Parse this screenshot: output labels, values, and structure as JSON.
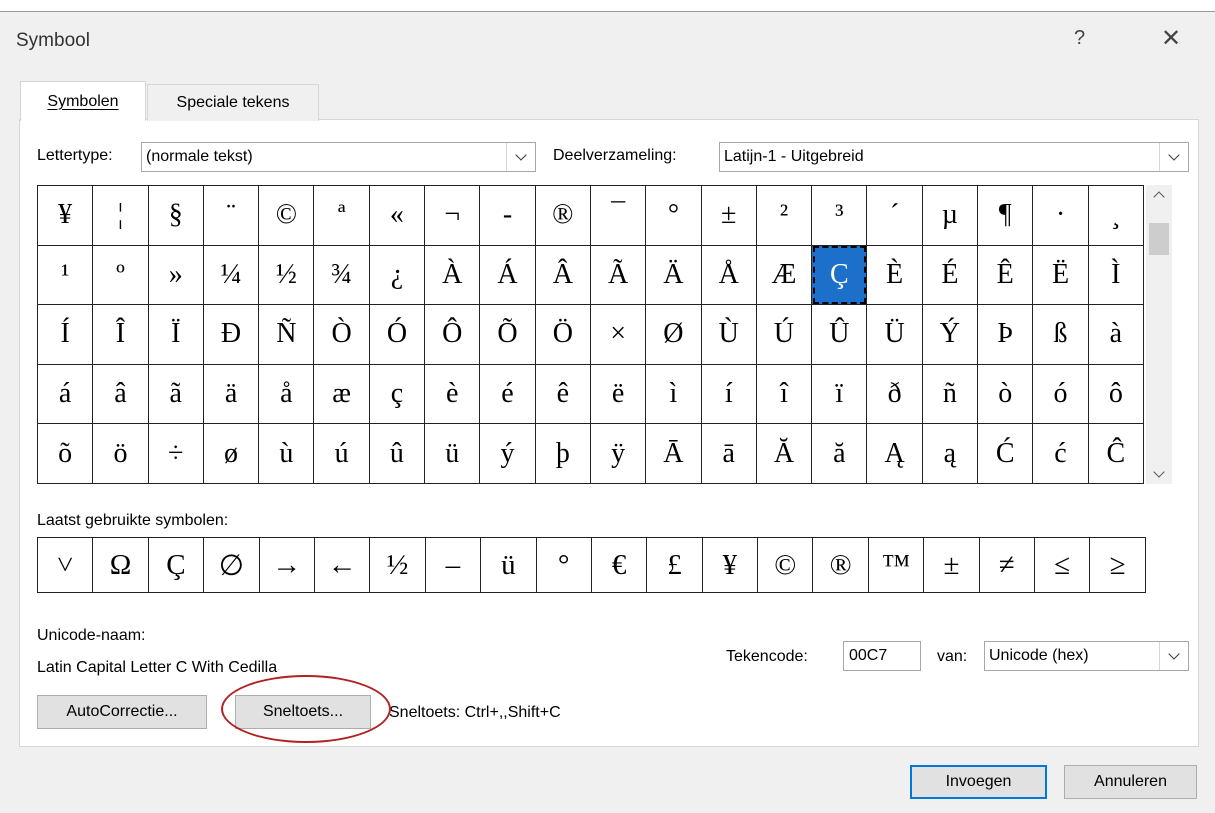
{
  "dialog": {
    "title": "Symbool",
    "help": "?",
    "close": "✕"
  },
  "tabs": [
    {
      "label": "Symbolen"
    },
    {
      "label": "Speciale tekens"
    }
  ],
  "font": {
    "label": "Lettertype:",
    "value": "(normale tekst)"
  },
  "subset": {
    "label": "Deelverzameling:",
    "value": "Latijn-1 - Uitgebreid"
  },
  "grid": {
    "rows": [
      [
        "¥",
        "¦",
        "§",
        "¨",
        "©",
        "ª",
        "«",
        "¬",
        "-",
        "®",
        "¯",
        "°",
        "±",
        "²",
        "³",
        "´",
        "µ",
        "¶",
        "·",
        "¸"
      ],
      [
        "¹",
        "º",
        "»",
        "¼",
        "½",
        "¾",
        "¿",
        "À",
        "Á",
        "Â",
        "Ã",
        "Ä",
        "Å",
        "Æ",
        "Ç",
        "È",
        "É",
        "Ê",
        "Ë",
        "Ì"
      ],
      [
        "Í",
        "Î",
        "Ï",
        "Ð",
        "Ñ",
        "Ò",
        "Ó",
        "Ô",
        "Õ",
        "Ö",
        "×",
        "Ø",
        "Ù",
        "Ú",
        "Û",
        "Ü",
        "Ý",
        "Þ",
        "ß",
        "à"
      ],
      [
        "á",
        "â",
        "ã",
        "ä",
        "å",
        "æ",
        "ç",
        "è",
        "é",
        "ê",
        "ë",
        "ì",
        "í",
        "î",
        "ï",
        "ð",
        "ñ",
        "ò",
        "ó",
        "ô"
      ],
      [
        "õ",
        "ö",
        "÷",
        "ø",
        "ù",
        "ú",
        "û",
        "ü",
        "ý",
        "þ",
        "ÿ",
        "Ā",
        "ā",
        "Ă",
        "ă",
        "Ą",
        "ą",
        "Ć",
        "ć",
        "Ĉ"
      ]
    ],
    "selected": "Ç"
  },
  "recent": {
    "label": "Laatst gebruikte symbolen:",
    "symbols": [
      "˅",
      "Ω",
      "Ç",
      "∅",
      "→",
      "←",
      "½",
      "–",
      "ü",
      "°",
      "€",
      "£",
      "¥",
      "©",
      "®",
      "™",
      "±",
      "≠",
      "≤",
      "≥"
    ]
  },
  "unicode_name": {
    "label": "Unicode-naam:",
    "value": "Latin Capital Letter C With Cedilla"
  },
  "charcode": {
    "label": "Tekencode:",
    "value": "00C7"
  },
  "from": {
    "label": "van:",
    "value": "Unicode (hex)"
  },
  "buttons": {
    "autocorrect": "AutoCorrectie...",
    "shortcut_key": "Sneltoets...",
    "insert": "Invoegen",
    "cancel": "Annuleren"
  },
  "shortcut_text": "Sneltoets: Ctrl+,,Shift+C",
  "colors": {
    "selection": "#1c70ca",
    "annotation": "#b32222",
    "default_button_border": "#0078d7"
  }
}
